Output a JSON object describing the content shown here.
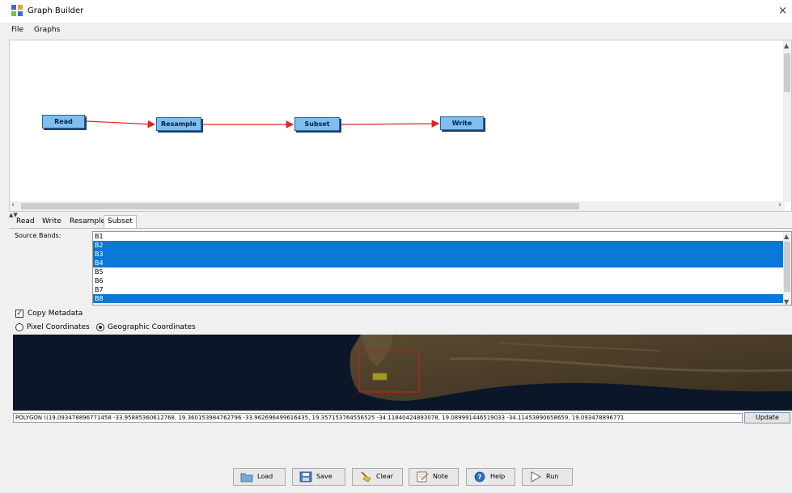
{
  "window": {
    "title": "Graph Builder",
    "close_glyph": "×"
  },
  "menu": [
    "File",
    "Graphs"
  ],
  "graph": {
    "nodes": [
      {
        "label": "Read"
      },
      {
        "label": "Resample"
      },
      {
        "label": "Subset"
      },
      {
        "label": "Write"
      }
    ],
    "edge_color": "#e02424",
    "node_color": "#7fbfef"
  },
  "tabs": [
    {
      "label": "Read",
      "active": false
    },
    {
      "label": "Write",
      "active": false
    },
    {
      "label": "Resample",
      "active": false
    },
    {
      "label": "Subset",
      "active": true
    }
  ],
  "subset": {
    "source_bands_label": "Source Bands:",
    "bands": [
      {
        "name": "B1",
        "selected": false
      },
      {
        "name": "B2",
        "selected": true
      },
      {
        "name": "B3",
        "selected": true
      },
      {
        "name": "B4",
        "selected": true
      },
      {
        "name": "B5",
        "selected": false
      },
      {
        "name": "B6",
        "selected": false
      },
      {
        "name": "B7",
        "selected": false
      },
      {
        "name": "B8",
        "selected": true
      }
    ],
    "copy_metadata_label": "Copy Metadata",
    "copy_metadata_checked": true,
    "pixel_coords_label": "Pixel Coordinates",
    "geo_coords_label": "Geographic Coordinates",
    "geo_coords_selected": true,
    "wkt_value": "POLYGON ((19.093478896771458 -33.95885360612768, 19.360153984762796 -33.962696499616435, 19.357153764556525 -34.11840424893078, 19.089991446519033 -34.11453890658659, 19.093478896771",
    "update_label": "Update",
    "selection_color": "#0a78d7"
  },
  "buttons": {
    "load": "Load",
    "save": "Save",
    "clear": "Clear",
    "note": "Note",
    "help": "Help",
    "run": "Run"
  },
  "icons": {
    "app": "graph-builder-icon",
    "load": "folder-icon",
    "save": "save-icon",
    "clear": "broom-icon",
    "note": "note-icon",
    "help": "help-icon",
    "run": "play-icon"
  }
}
